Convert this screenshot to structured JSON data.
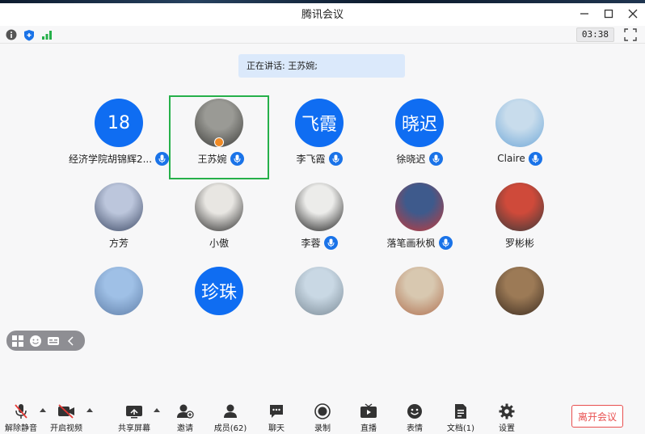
{
  "window": {
    "title": "腾讯会议"
  },
  "top_toolbar": {
    "timer": "03:38"
  },
  "speaking_banner": {
    "text": "正在讲话: 王苏婉;"
  },
  "participants": [
    {
      "name": "经济学院胡锦辉2...",
      "avatar_text": "18",
      "avatar_type": "text",
      "mic": true
    },
    {
      "name": "王苏婉",
      "avatar_text": "",
      "avatar_type": "photo",
      "mic": true,
      "active": true,
      "host": true
    },
    {
      "name": "李飞霞",
      "avatar_text": "飞霞",
      "avatar_type": "text",
      "mic": true
    },
    {
      "name": "徐晓迟",
      "avatar_text": "晓迟",
      "avatar_type": "text",
      "mic": true
    },
    {
      "name": "Claire",
      "avatar_text": "",
      "avatar_type": "photo",
      "mic": true
    },
    {
      "name": "方芳",
      "avatar_text": "",
      "avatar_type": "photo",
      "mic": false
    },
    {
      "name": "小傲",
      "avatar_text": "",
      "avatar_type": "photo",
      "mic": false
    },
    {
      "name": "李蓉",
      "avatar_text": "",
      "avatar_type": "photo",
      "mic": true
    },
    {
      "name": "落笔画秋枫",
      "avatar_text": "",
      "avatar_type": "photo",
      "mic": true
    },
    {
      "name": "罗彬彬",
      "avatar_text": "",
      "avatar_type": "photo",
      "mic": false
    },
    {
      "name": "",
      "avatar_text": "",
      "avatar_type": "photo",
      "mic": false
    },
    {
      "name": "",
      "avatar_text": "珍珠",
      "avatar_type": "text",
      "mic": false
    },
    {
      "name": "",
      "avatar_text": "",
      "avatar_type": "photo",
      "mic": false
    },
    {
      "name": "",
      "avatar_text": "",
      "avatar_type": "photo",
      "mic": false
    },
    {
      "name": "",
      "avatar_text": "",
      "avatar_type": "photo",
      "mic": false
    }
  ],
  "bottom_toolbar": {
    "unmute": "解除静音",
    "start_video": "开启视频",
    "share_screen": "共享屏幕",
    "invite": "邀请",
    "members": "成员(62)",
    "chat": "聊天",
    "record": "录制",
    "live": "直播",
    "reactions": "表情",
    "docs": "文档(1)",
    "settings": "设置",
    "leave": "离开会议"
  },
  "colors": {
    "accent": "#0f6df2",
    "active_border": "#26b04a",
    "leave": "#e84f4f",
    "banner": "#dbe9fb"
  }
}
